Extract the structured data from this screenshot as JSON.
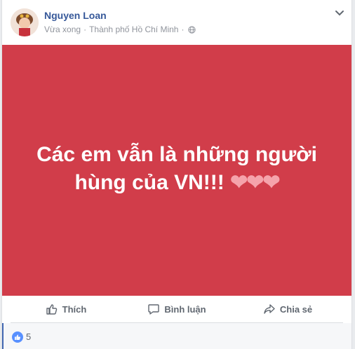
{
  "post": {
    "author": "Nguyen Loan",
    "time": "Vừa xong",
    "location": "Thành phố Hồ Chí Minh",
    "separator": "·",
    "status_text": "Các em vẫn là những người hùng của VN!!!",
    "status_emoji": "❤❤❤",
    "banner_color": "#d13d4a"
  },
  "actions": {
    "like": "Thích",
    "comment": "Bình luận",
    "share": "Chia sẻ"
  },
  "reactions": {
    "count": "5"
  },
  "icons": {
    "avatar": "profile-photo",
    "privacy": "globe-icon",
    "menu": "chevron-down-icon",
    "like": "thumbs-up-icon",
    "comment": "speech-bubble-icon",
    "share": "share-arrow-icon"
  },
  "colors": {
    "author_link": "#365899",
    "like_badge": "#5890ff",
    "muted_text": "#90949c"
  }
}
